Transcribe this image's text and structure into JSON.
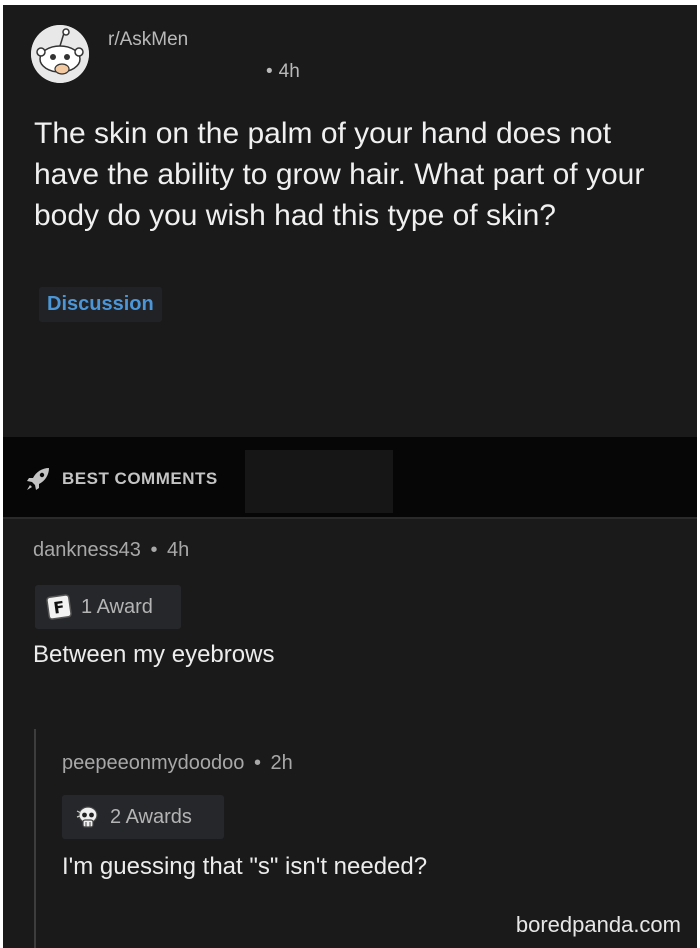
{
  "post": {
    "subreddit": "r/AskMen",
    "time": "4h",
    "title": "The skin on the palm of your hand does not have the ability to grow hair. What part of your body do you wish had this type of skin?",
    "flair": "Discussion"
  },
  "sort": {
    "label": "BEST COMMENTS"
  },
  "comments": [
    {
      "author": "dankness43",
      "time": "4h",
      "awards": "1 Award",
      "body": "Between my eyebrows"
    },
    {
      "author": "peepeeonmydoodoo",
      "time": "2h",
      "awards": "2 Awards",
      "body": "I'm guessing that \"s\" isn't needed?"
    }
  ],
  "separator": "•",
  "watermark": "boredpanda.com",
  "colors": {
    "background": "#1a1a1b",
    "flair": "#4c95d6",
    "text": "#f0f0f0"
  }
}
